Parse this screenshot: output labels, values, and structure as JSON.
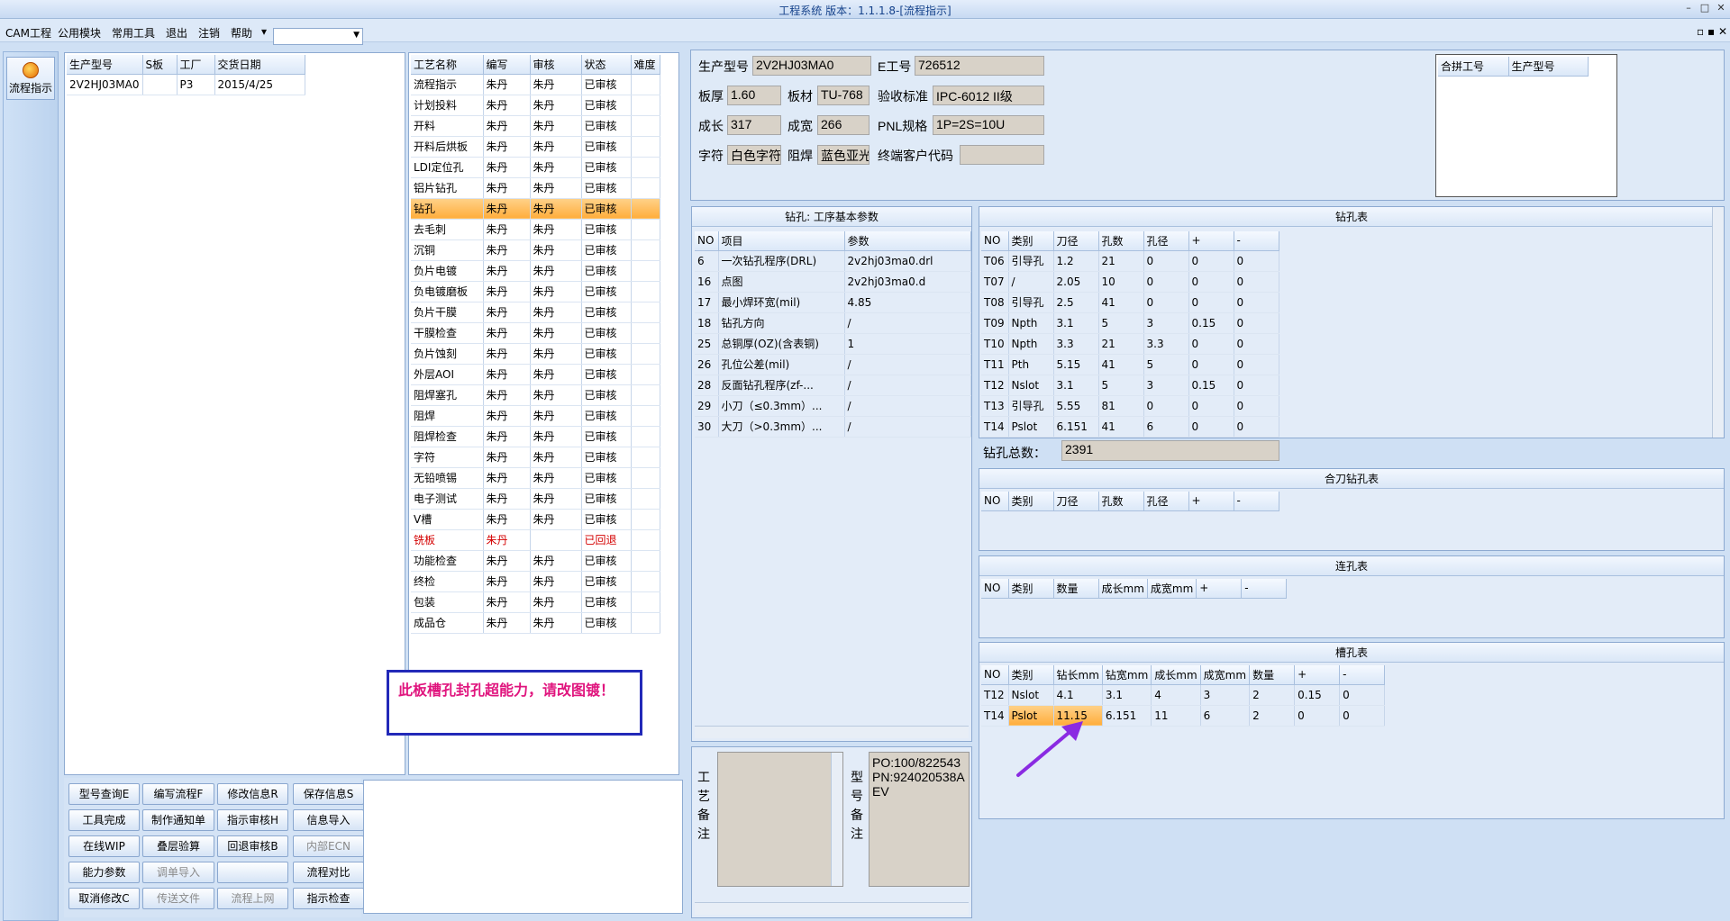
{
  "window": {
    "title": "工程系统 版本：1.1.1.8-[流程指示]"
  },
  "menu": {
    "items": [
      "CAM工程",
      "公用模块",
      "常用工具",
      "退出",
      "注销",
      "帮助"
    ],
    "help_arrow": "▾"
  },
  "sidebar": {
    "button_label": "流程指示"
  },
  "orders": {
    "headers": [
      "生产型号",
      "S板",
      "工厂",
      "交货日期"
    ],
    "rows": [
      [
        "2V2HJ03MA0",
        "",
        "P3",
        "2015/4/25"
      ]
    ]
  },
  "process": {
    "headers": [
      "工艺名称",
      "编写",
      "审核",
      "状态",
      "难度"
    ],
    "rows": [
      [
        "流程指示",
        "朱丹",
        "朱丹",
        "已审核",
        ""
      ],
      [
        "计划投料",
        "朱丹",
        "朱丹",
        "已审核",
        ""
      ],
      [
        "开料",
        "朱丹",
        "朱丹",
        "已审核",
        ""
      ],
      [
        "开料后烘板",
        "朱丹",
        "朱丹",
        "已审核",
        ""
      ],
      [
        "LDI定位孔",
        "朱丹",
        "朱丹",
        "已审核",
        ""
      ],
      [
        "铝片钻孔",
        "朱丹",
        "朱丹",
        "已审核",
        ""
      ],
      [
        "钻孔",
        "朱丹",
        "朱丹",
        "已审核",
        ""
      ],
      [
        "去毛刺",
        "朱丹",
        "朱丹",
        "已审核",
        ""
      ],
      [
        "沉铜",
        "朱丹",
        "朱丹",
        "已审核",
        ""
      ],
      [
        "负片电镀",
        "朱丹",
        "朱丹",
        "已审核",
        ""
      ],
      [
        "负电镀磨板",
        "朱丹",
        "朱丹",
        "已审核",
        ""
      ],
      [
        "负片干膜",
        "朱丹",
        "朱丹",
        "已审核",
        ""
      ],
      [
        "干膜检查",
        "朱丹",
        "朱丹",
        "已审核",
        ""
      ],
      [
        "负片蚀刻",
        "朱丹",
        "朱丹",
        "已审核",
        ""
      ],
      [
        "外层AOI",
        "朱丹",
        "朱丹",
        "已审核",
        ""
      ],
      [
        "阻焊塞孔",
        "朱丹",
        "朱丹",
        "已审核",
        ""
      ],
      [
        "阻焊",
        "朱丹",
        "朱丹",
        "已审核",
        ""
      ],
      [
        "阻焊检查",
        "朱丹",
        "朱丹",
        "已审核",
        ""
      ],
      [
        "字符",
        "朱丹",
        "朱丹",
        "已审核",
        ""
      ],
      [
        "无铅喷锡",
        "朱丹",
        "朱丹",
        "已审核",
        ""
      ],
      [
        "电子测试",
        "朱丹",
        "朱丹",
        "已审核",
        ""
      ],
      [
        "V槽",
        "朱丹",
        "朱丹",
        "已审核",
        ""
      ],
      [
        "铣板",
        "朱丹",
        "",
        "已回退",
        ""
      ],
      [
        "功能检查",
        "朱丹",
        "朱丹",
        "已审核",
        ""
      ],
      [
        "终检",
        "朱丹",
        "朱丹",
        "已审核",
        ""
      ],
      [
        "包装",
        "朱丹",
        "朱丹",
        "已审核",
        ""
      ],
      [
        "成品仓",
        "朱丹",
        "朱丹",
        "已审核",
        ""
      ]
    ],
    "selected_index": 6,
    "red_index": 22
  },
  "warning": {
    "text": "此板槽孔封孔超能力，请改图镀！"
  },
  "buttons": [
    [
      "型号查询E",
      "编写流程F",
      "修改信息R",
      "保存信息S"
    ],
    [
      "工具完成",
      "制作通知单",
      "指示审核H",
      "信息导入"
    ],
    [
      "在线WIP",
      "叠层验算",
      "回退审核B",
      "内部ECN"
    ],
    [
      "能力参数",
      "调单导入",
      "",
      "流程对比"
    ],
    [
      "取消修改C",
      "传送文件",
      "流程上网",
      "指示检查"
    ]
  ],
  "disabled_buttons": [
    "内部ECN",
    "调单导入",
    "传送文件",
    "流程上网"
  ],
  "info": {
    "prod_model_label": "生产型号",
    "prod_model": "2V2HJ03MA0",
    "e_no_label": "E工号",
    "e_no": "726512",
    "thickness_label": "板厚",
    "thickness": "1.60",
    "material_label": "板材",
    "material": "TU-768",
    "std_label": "验收标准",
    "std": "IPC-6012 II级",
    "len_label": "成长",
    "len": "317",
    "wid_label": "成宽",
    "wid": "266",
    "pnl_label": "PNL规格",
    "pnl": "1P=2S=10U",
    "char_label": "字符",
    "char": "白色字符",
    "mask_label": "阻焊",
    "mask": "蓝色亚光",
    "cust_label": "终端客户代码",
    "cust": ""
  },
  "merge": {
    "headers": [
      "合拼工号",
      "生产型号"
    ]
  },
  "params": {
    "title": "钻孔: 工序基本参数",
    "headers": [
      "NO",
      "项目",
      "参数"
    ],
    "rows": [
      [
        "6",
        "一次钻孔程序(DRL)",
        "2v2hj03ma0.drl"
      ],
      [
        "16",
        "点图",
        "2v2hj03ma0.d"
      ],
      [
        "17",
        "最小焊环宽(mil)",
        "4.85"
      ],
      [
        "18",
        "钻孔方向",
        "/"
      ],
      [
        "25",
        "总铜厚(OZ)(含表铜)",
        "1"
      ],
      [
        "26",
        "孔位公差(mil)",
        "/"
      ],
      [
        "28",
        "反面钻孔程序(zf-...",
        "/"
      ],
      [
        "29",
        "小刀（≤0.3mm）...",
        "/"
      ],
      [
        "30",
        "大刀（>0.3mm）...",
        "/"
      ]
    ]
  },
  "drill": {
    "title": "钻孔表",
    "headers": [
      "NO",
      "类别",
      "刀径",
      "孔数",
      "孔径",
      "+",
      "-"
    ],
    "rows": [
      [
        "T06",
        "引导孔",
        "1.2",
        "21",
        "0",
        "0",
        "0"
      ],
      [
        "T07",
        "/",
        "2.05",
        "10",
        "0",
        "0",
        "0"
      ],
      [
        "T08",
        "引导孔",
        "2.5",
        "41",
        "0",
        "0",
        "0"
      ],
      [
        "T09",
        "Npth",
        "3.1",
        "5",
        "3",
        "0.15",
        "0"
      ],
      [
        "T10",
        "Npth",
        "3.3",
        "21",
        "3.3",
        "0",
        "0"
      ],
      [
        "T11",
        "Pth",
        "5.15",
        "41",
        "5",
        "0",
        "0"
      ],
      [
        "T12",
        "Nslot",
        "3.1",
        "5",
        "3",
        "0.15",
        "0"
      ],
      [
        "T13",
        "引导孔",
        "5.55",
        "81",
        "0",
        "0",
        "0"
      ],
      [
        "T14",
        "Pslot",
        "6.151",
        "41",
        "6",
        "0",
        "0"
      ]
    ],
    "total_label": "钻孔总数：",
    "total": "2391"
  },
  "combined": {
    "title": "合刀钻孔表",
    "headers": [
      "NO",
      "类别",
      "刀径",
      "孔数",
      "孔径",
      "+",
      "-"
    ]
  },
  "connected": {
    "title": "连孔表",
    "headers": [
      "NO",
      "类别",
      "数量",
      "成长mm",
      "成宽mm",
      "+",
      "-"
    ]
  },
  "slot": {
    "title": "槽孔表",
    "headers": [
      "NO",
      "类别",
      "钻长mm",
      "钻宽mm",
      "成长mm",
      "成宽mm",
      "数量",
      "+",
      "-"
    ],
    "rows": [
      [
        "T12",
        "Nslot",
        "4.1",
        "3.1",
        "4",
        "3",
        "2",
        "0.15",
        "0"
      ],
      [
        "T14",
        "Pslot",
        "11.15",
        "6.151",
        "11",
        "6",
        "2",
        "0",
        "0"
      ]
    ]
  },
  "notes": {
    "process_label": "工艺备注",
    "model_label": "型号备注",
    "model_text": "PO:100/822543 PN:924020538AEV"
  },
  "annotation": {
    "arrow_color": "#8a2be2"
  }
}
